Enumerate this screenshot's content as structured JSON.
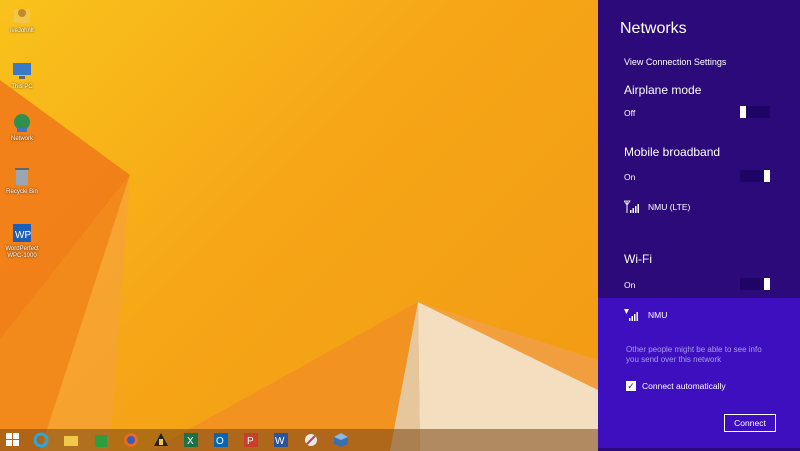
{
  "desktop": {
    "icons": [
      {
        "label": "iveJohnlt",
        "icon": "folder-user-icon"
      },
      {
        "label": "This PC",
        "icon": "computer-icon"
      },
      {
        "label": "Network",
        "icon": "network-icon"
      },
      {
        "label": "Recycle Bin",
        "icon": "recycle-bin-icon"
      },
      {
        "label": "WordPerfect WPC-1000",
        "icon": "wordperfect-icon"
      }
    ]
  },
  "taskbar": {
    "items": [
      "start-icon",
      "internet-explorer-icon",
      "file-explorer-icon",
      "store-icon",
      "firefox-icon",
      "app-icon",
      "excel-icon",
      "outlook-icon",
      "powerpoint-icon",
      "word-icon",
      "tool-icon",
      "virtualbox-icon"
    ]
  },
  "networks": {
    "title": "Networks",
    "view_settings": "View Connection Settings",
    "airplane": {
      "label": "Airplane mode",
      "state": "Off",
      "on": false
    },
    "mobile": {
      "label": "Mobile broadband",
      "state": "On",
      "on": true,
      "network": "NMU (LTE)"
    },
    "wifi": {
      "label": "Wi-Fi",
      "state": "On",
      "on": true,
      "network": "NMU",
      "note": "Other people might be able to see info you send over this network",
      "connect_auto": "Connect automatically",
      "connect_button": "Connect"
    }
  },
  "colors": {
    "charm_bg": "#2d0a7a",
    "wifi_panel": "#3d0fbf"
  }
}
